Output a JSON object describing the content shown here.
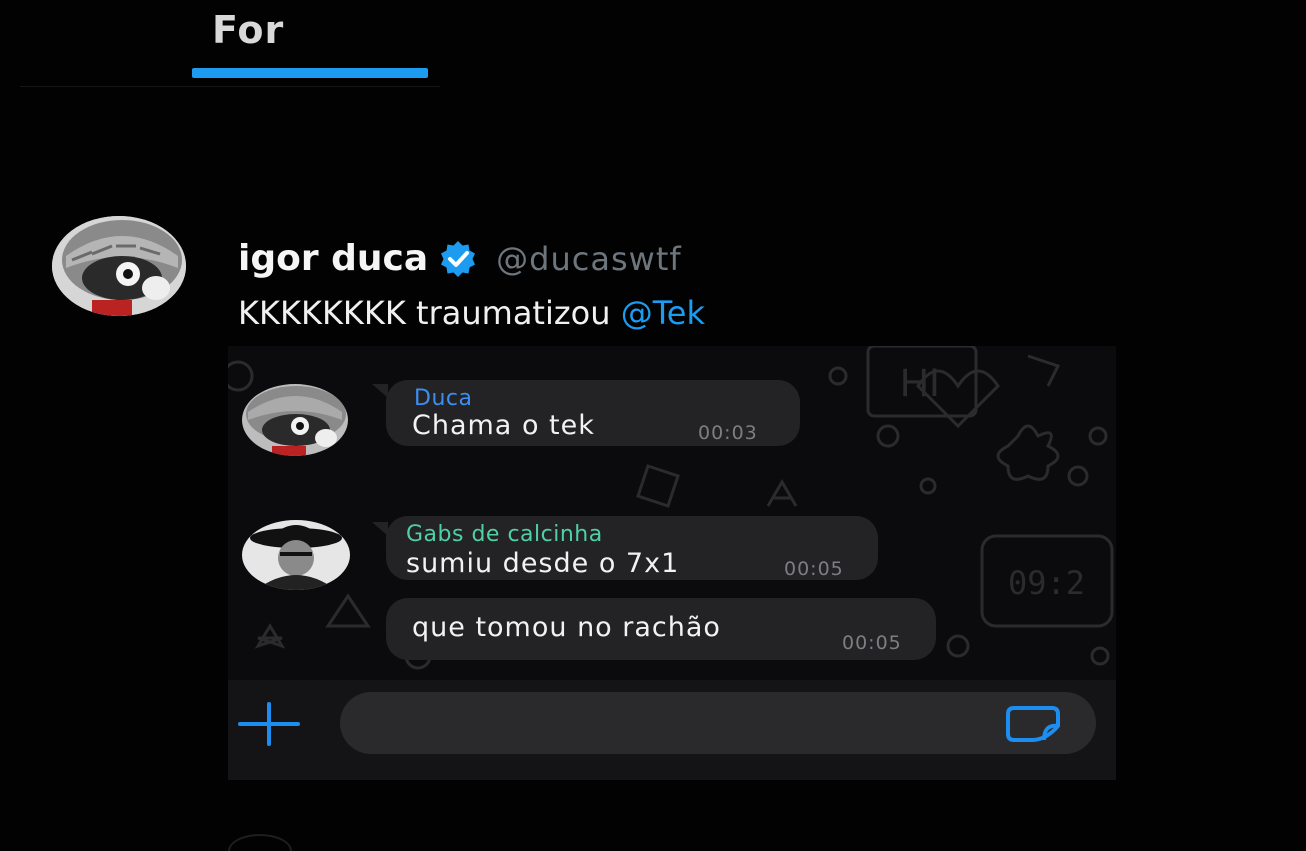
{
  "top_tab": {
    "label": "For",
    "accent": "#1d9bf0"
  },
  "tweet": {
    "display_name": "igor duca",
    "handle": "@ducaswtf",
    "text": "KKKKKKKK traumatizou ",
    "mention": "@Tek",
    "verified_icon": "verified-badge-icon"
  },
  "chat": {
    "messages": [
      {
        "sender": "Duca",
        "sender_color": "#3d8ef0",
        "text": "Chama o tek",
        "time": "00:03"
      },
      {
        "sender": "Gabs de calcinha",
        "sender_color": "#4fd1a3",
        "text": "sumiu desde o 7x1",
        "time": "00:05"
      },
      {
        "sender": "",
        "text": "que tomou no rachão",
        "time": "00:05"
      }
    ],
    "composer": {
      "add_icon": "plus-icon",
      "sticker_icon": "sticker-icon",
      "placeholder": ""
    }
  }
}
